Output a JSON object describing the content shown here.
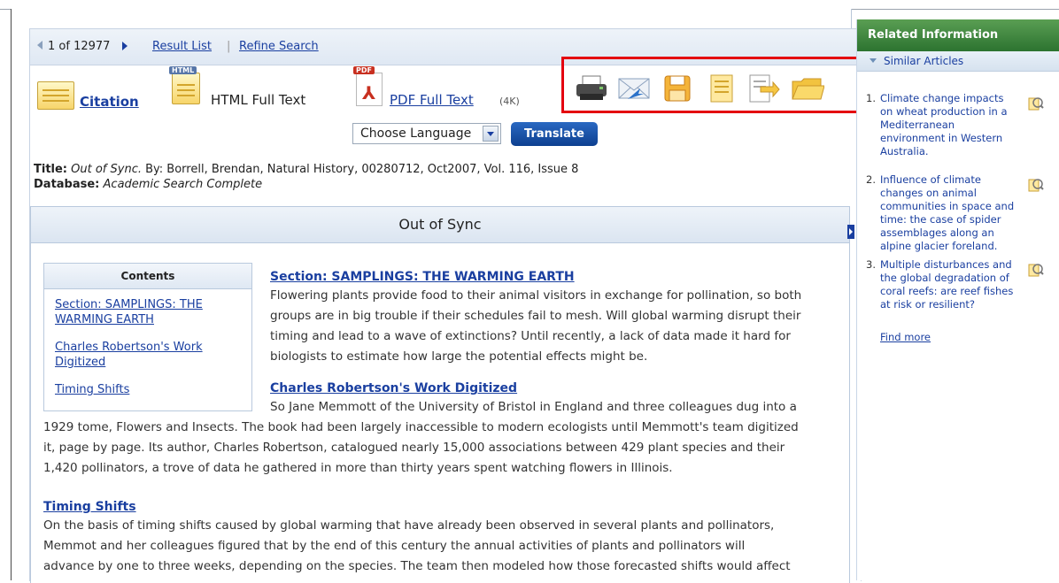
{
  "nav": {
    "position": "1 of 12977",
    "result_list": "Result List",
    "separator": "|",
    "refine_search": "Refine Search"
  },
  "formats": {
    "citation": "Citation",
    "html_full_text": "HTML Full Text",
    "html_tag": "HTML",
    "pdf_full_text": "PDF Full Text",
    "pdf_size": "(4K)",
    "pdf_tag": "PDF"
  },
  "tools": [
    "print-icon",
    "email-icon",
    "save-icon",
    "cite-icon",
    "export-icon",
    "folder-icon"
  ],
  "translate": {
    "select_value": "Choose Language",
    "button": "Translate"
  },
  "citation": {
    "title_label": "Title:",
    "title_value": "Out of Sync.",
    "rest": " By: Borrell, Brendan, Natural History, 00280712, Oct2007, Vol. 116, Issue 8",
    "database_label": "Database:",
    "database_value": "Academic Search Complete"
  },
  "article": {
    "heading": "Out of Sync",
    "contents": {
      "title": "Contents",
      "items": [
        "Section: SAMPLINGS: THE WARMING EARTH",
        "Charles Robertson's Work Digitized",
        "Timing Shifts"
      ]
    },
    "sections": [
      {
        "title": "Section: SAMPLINGS: THE WARMING EARTH",
        "lines": [
          "Flowering plants provide food to their animal visitors in exchange for pollination, so both",
          "groups are in big trouble if their schedules fail to mesh. Will global warming disrupt their",
          "timing and lead to a wave of extinctions? Until recently, a lack of data made it hard for",
          "biologists to estimate how large the potential effects might be."
        ]
      },
      {
        "title": "Charles Robertson's Work Digitized",
        "lines": [
          "So Jane Memmott of the University of Bristol in England and three colleagues dug into a",
          "1929 tome, Flowers and Insects. The book had been largely inaccessible to modern ecologists until Memmott's team digitized",
          "it, page by page. Its author, Charles Robertson, catalogued nearly 15,000 associations between 429 plant species and their",
          "1,420 pollinators, a trove of data he gathered in more than thirty years spent watching flowers in Illinois."
        ]
      },
      {
        "title": "Timing Shifts",
        "lines": [
          "On the basis of timing shifts caused by global warming that have already been observed in several plants and pollinators,",
          "Memmot and her colleagues figured that by the end of this century the annual activities of plants and pollinators will",
          "advance by one to three weeks, depending on the species. The team then modeled how those forecasted shifts would affect"
        ]
      }
    ]
  },
  "related": {
    "header": "Related Information",
    "similar_header": "Similar Articles",
    "items": [
      {
        "num": "1.",
        "text": "Climate change impacts on wheat production in a Mediterranean environment in Western Australia."
      },
      {
        "num": "2.",
        "text": "Influence of climate changes on animal communities in space and time: the case of spider assemblages along an alpine glacier foreland."
      },
      {
        "num": "3.",
        "text": "Multiple disturbances and the global degradation of coral reefs: are reef fishes at risk or resilient?"
      }
    ],
    "find_more": "Find more"
  },
  "colors": {
    "link": "#1a3fa0",
    "highlight": "#e4000f",
    "related_header": "#2c7330",
    "translate_button": "#0d3f8f"
  }
}
